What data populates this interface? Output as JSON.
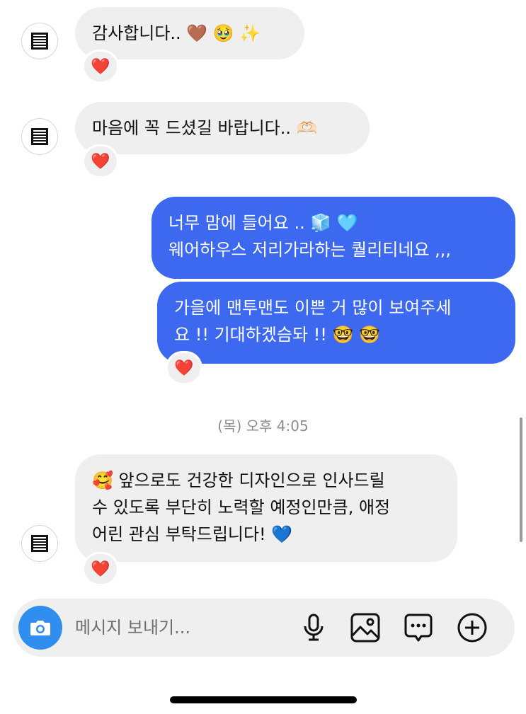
{
  "messages": [
    {
      "from": "them",
      "text": "감사합니다..",
      "emojis": [
        "🤎",
        "🥹",
        "✨"
      ],
      "reaction": "❤️"
    },
    {
      "from": "them",
      "text": "마음에 꼭 드셨길 바랍니다..",
      "emojis": [
        "🫶🏻"
      ],
      "reaction": "❤️"
    },
    {
      "from": "me",
      "lines": [
        "너무 맘에 들어요 ..",
        "웨어하우스 저리가라하는 퀄리티네요 ,,,"
      ],
      "emojis": [
        "🧊",
        "🩵"
      ]
    },
    {
      "from": "me",
      "lines": [
        "가을에 맨투맨도 이쁜 거 많이 보여주세",
        "요 !! 기대하겠슴돠 !!"
      ],
      "emojis": [
        "🤓",
        "🤓"
      ],
      "reaction": "❤️"
    },
    {
      "from": "them",
      "lines": [
        "앞으로도 건강한 디자인으로 인사드릴",
        "수 있도록 부단히 노력할 예정인만큼, 애정",
        "어린 관심 부탁드립니다!"
      ],
      "lead_emoji": "🥰",
      "emojis": [
        "💙"
      ],
      "reaction": "❤️"
    }
  ],
  "timestamp": "(목) 오후 4:05",
  "composer": {
    "placeholder": "메시지 보내기..."
  },
  "icons": {
    "camera": "camera-icon",
    "mic": "microphone-icon",
    "gallery": "gallery-icon",
    "sticker": "chat-bubble-icon",
    "add": "plus-circle-icon"
  },
  "colors": {
    "outgoing_bubble": "#3c69f0",
    "incoming_bubble": "#efefef",
    "camera_button": "#2f8ef0",
    "reaction_heart": "#e0233c"
  }
}
